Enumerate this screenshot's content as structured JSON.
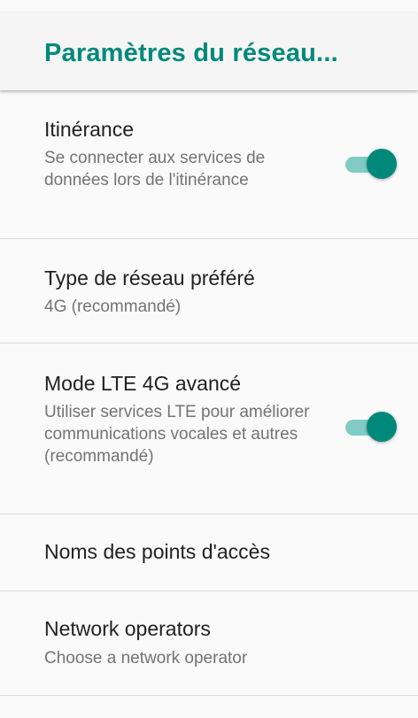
{
  "app_bar": {
    "title": "Paramètres du réseau..."
  },
  "settings": {
    "roaming": {
      "title": "Itinérance",
      "summary": "Se connecter aux services de données lors de l'itinérance",
      "toggle_on": true
    },
    "preferred_network_type": {
      "title": "Type de réseau préféré",
      "summary": "4G (recommandé)"
    },
    "enhanced_lte": {
      "title": "Mode LTE 4G avancé",
      "summary": "Utiliser services LTE pour améliorer communications vocales et autres (recommandé)",
      "toggle_on": true
    },
    "access_point_names": {
      "title": "Noms des points d'accès"
    },
    "network_operators": {
      "title": "Network operators",
      "summary": "Choose a network operator"
    }
  },
  "colors": {
    "accent": "#00897b",
    "toggle_track": "#80cbc4",
    "title_text": "#212121",
    "summary_text": "#737373",
    "background": "#fafafa",
    "divider": "#dcdcdc"
  }
}
